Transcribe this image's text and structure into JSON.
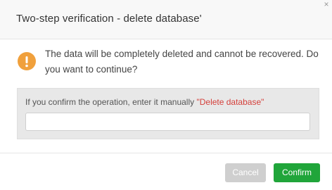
{
  "dialog": {
    "title": "Two-step verification - delete database'",
    "close_glyph": "×",
    "message": "The data will be completely deleted and cannot be recovered. Do you want to continue?",
    "confirm": {
      "prompt": "If you confirm the operation, enter it manually ",
      "keyword": "\"Delete database\"",
      "input_value": "",
      "input_placeholder": ""
    },
    "buttons": {
      "cancel_label": "Cancel",
      "confirm_label": "Confirm"
    },
    "icons": {
      "warning": "exclamation-circle-icon",
      "close": "close-icon"
    },
    "colors": {
      "warning_icon": "#f0a03c",
      "keyword_text": "#d43f3a",
      "confirm_button": "#20a53a",
      "cancel_button": "#cfcfcf"
    }
  }
}
